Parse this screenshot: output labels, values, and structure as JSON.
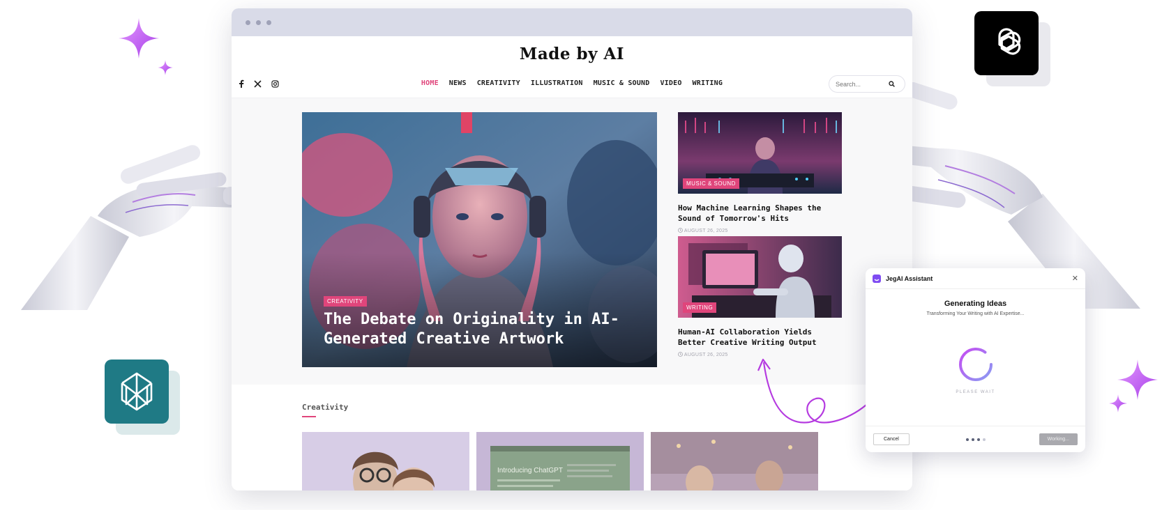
{
  "site": {
    "logo": "Made by AI",
    "nav": [
      "HOME",
      "NEWS",
      "CREATIVITY",
      "ILLUSTRATION",
      "MUSIC & SOUND",
      "VIDEO",
      "WRITING"
    ],
    "search_placeholder": "Search..."
  },
  "hero": {
    "tag": "CREATIVITY",
    "title": "The Debate on Originality in AI-Generated Creative Artwork"
  },
  "side_posts": [
    {
      "tag": "MUSIC & SOUND",
      "title": "How Machine Learning Shapes the Sound of Tomorrow's Hits",
      "date": "AUGUST 26, 2025"
    },
    {
      "tag": "WRITING",
      "title": "Human-AI Collaboration Yields Better Creative Writing Output",
      "date": "AUGUST 26, 2025"
    }
  ],
  "section": {
    "title": "Creativity"
  },
  "card2_text": "Introducing ChatGPT",
  "assistant": {
    "title": "JegAI Assistant",
    "heading": "Generating Ideas",
    "subtitle": "Transforming Your Writing with AI Expertise...",
    "wait": "PLEASE WAIT",
    "cancel": "Cancel",
    "working": "Working..."
  },
  "colors": {
    "accent": "#e0457b",
    "sparkle": "#c04cf0",
    "perplexity_tile": "#1f7a85",
    "openai_tile": "#000000"
  },
  "icons": [
    "facebook-icon",
    "x-icon",
    "instagram-icon",
    "search-icon",
    "openai-icon",
    "perplexity-icon",
    "sparkle-icon",
    "close-icon",
    "spinner-icon"
  ]
}
